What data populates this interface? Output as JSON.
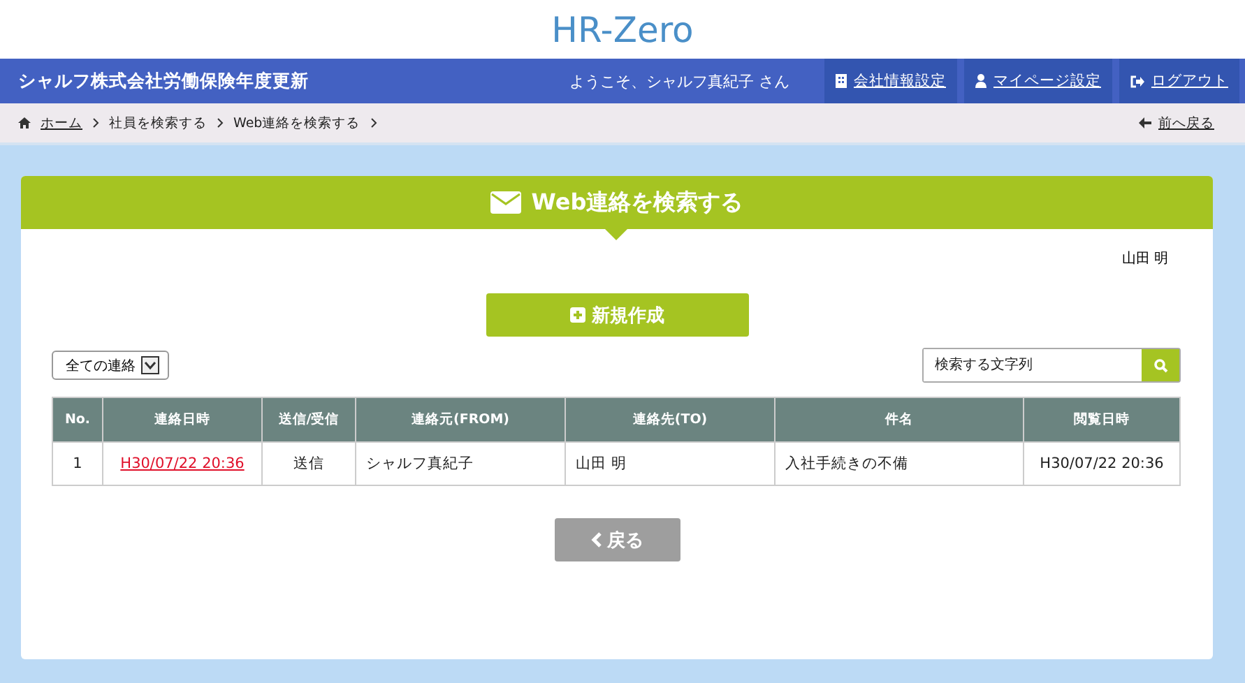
{
  "logo": "HR-Zero",
  "header": {
    "title": "シャルフ株式会社労働保険年度更新",
    "welcome": "ようこそ、シャルフ真紀子 さん",
    "links": [
      {
        "kind": "building",
        "label": "会社情報設定"
      },
      {
        "kind": "user",
        "label": "マイページ設定"
      },
      {
        "kind": "logout",
        "label": "ログアウト"
      }
    ]
  },
  "breadcrumb": {
    "items": [
      {
        "label": "ホーム",
        "link": true
      },
      {
        "label": "社員を検索する",
        "link": false
      },
      {
        "label": "Web連絡を検索する",
        "link": false
      }
    ],
    "back": "前へ戻る"
  },
  "panel": {
    "title": "Web連絡を検索する",
    "user": "山田 明",
    "new_button": "新規作成",
    "filter": "全ての連絡",
    "search": {
      "placeholder": "検索する文字列"
    },
    "table": {
      "columns": [
        "No.",
        "連絡日時",
        "送信/受信",
        "連絡元(FROM)",
        "連絡先(TO)",
        "件名",
        "閲覧日時"
      ],
      "rows": [
        {
          "cells": [
            "1",
            "H30/07/22 20:36",
            "送信",
            "シャルフ真紀子",
            "山田 明",
            "入社手続きの不備",
            "H30/07/22 20:36"
          ]
        }
      ]
    },
    "back_button": "戻る"
  }
}
